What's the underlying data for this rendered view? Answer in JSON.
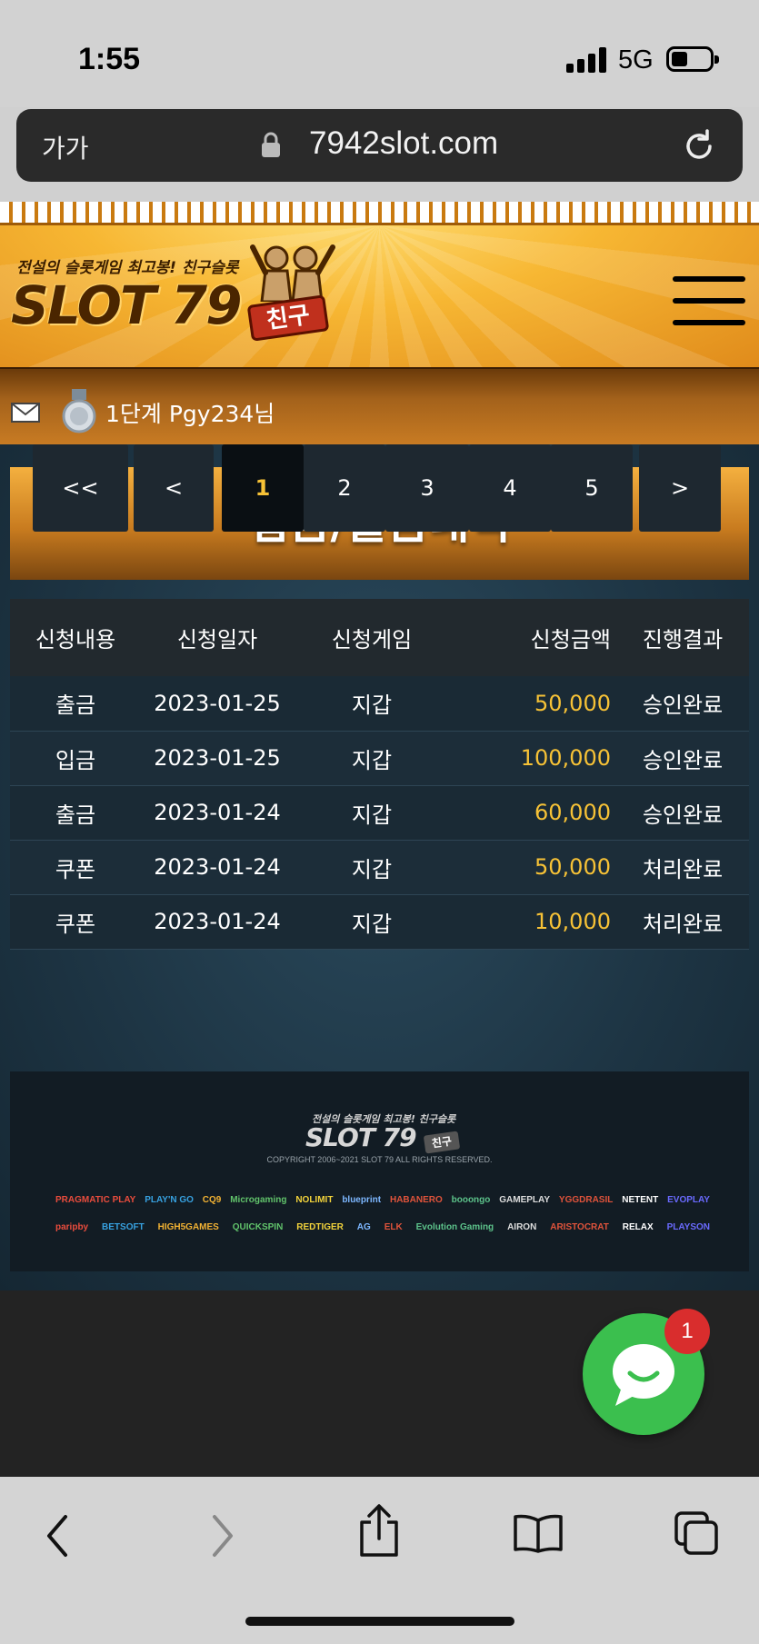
{
  "status_bar": {
    "time": "1:55",
    "network": "5G"
  },
  "browser": {
    "text_size_label": "가가",
    "url": "7942slot.com"
  },
  "site": {
    "logo_tagline": "전설의 슬롯게임 최고봉! 친구슬롯",
    "logo_text": "SLOT 79",
    "logo_badge": "친구"
  },
  "user": {
    "label": "1단계 Pgy234님"
  },
  "page_title": "입금/출금내역",
  "table": {
    "headers": [
      "신청내용",
      "신청일자",
      "신청게임",
      "신청금액",
      "진행결과"
    ],
    "rows": [
      [
        "출금",
        "2023-01-25",
        "지갑",
        "50,000",
        "승인완료"
      ],
      [
        "입금",
        "2023-01-25",
        "지갑",
        "100,000",
        "승인완료"
      ],
      [
        "출금",
        "2023-01-24",
        "지갑",
        "60,000",
        "승인완료"
      ],
      [
        "쿠폰",
        "2023-01-24",
        "지갑",
        "50,000",
        "처리완료"
      ],
      [
        "쿠폰",
        "2023-01-24",
        "지갑",
        "10,000",
        "처리완료"
      ]
    ]
  },
  "pagination": {
    "first": "<<",
    "prev": "<",
    "pages": [
      "1",
      "2",
      "3",
      "4",
      "5"
    ],
    "current": "1",
    "next": ">"
  },
  "footer": {
    "logo_tagline": "전설의 슬롯게임 최고봉! 친구슬롯",
    "logo_text": "SLOT 79",
    "logo_badge": "친구",
    "copyright": "COPYRIGHT 2006~2021 SLOT 79 ALL RIGHTS RESERVED.",
    "providers_row1": [
      "PRAGMATIC PLAY",
      "PLAY'N GO",
      "CQ9",
      "Microgaming",
      "NOLIMIT",
      "blueprint",
      "HABANERO",
      "booongo",
      "GAMEPLAY",
      "YGGDRASIL",
      "NETENT",
      "EVOPLAY"
    ],
    "providers_row2": [
      "paripby",
      "BETSOFT",
      "HIGH5GAMES",
      "QUICKSPIN",
      "REDTIGER",
      "AG",
      "ELK",
      "Evolution Gaming",
      "AIRON",
      "ARISTOCRAT",
      "RELAX",
      "PLAYSON"
    ]
  },
  "chat": {
    "badge_count": "1"
  },
  "colors": {
    "accent_gold": "#f7c236",
    "chat_green": "#3bbf4e",
    "badge_red": "#d92d2d"
  }
}
